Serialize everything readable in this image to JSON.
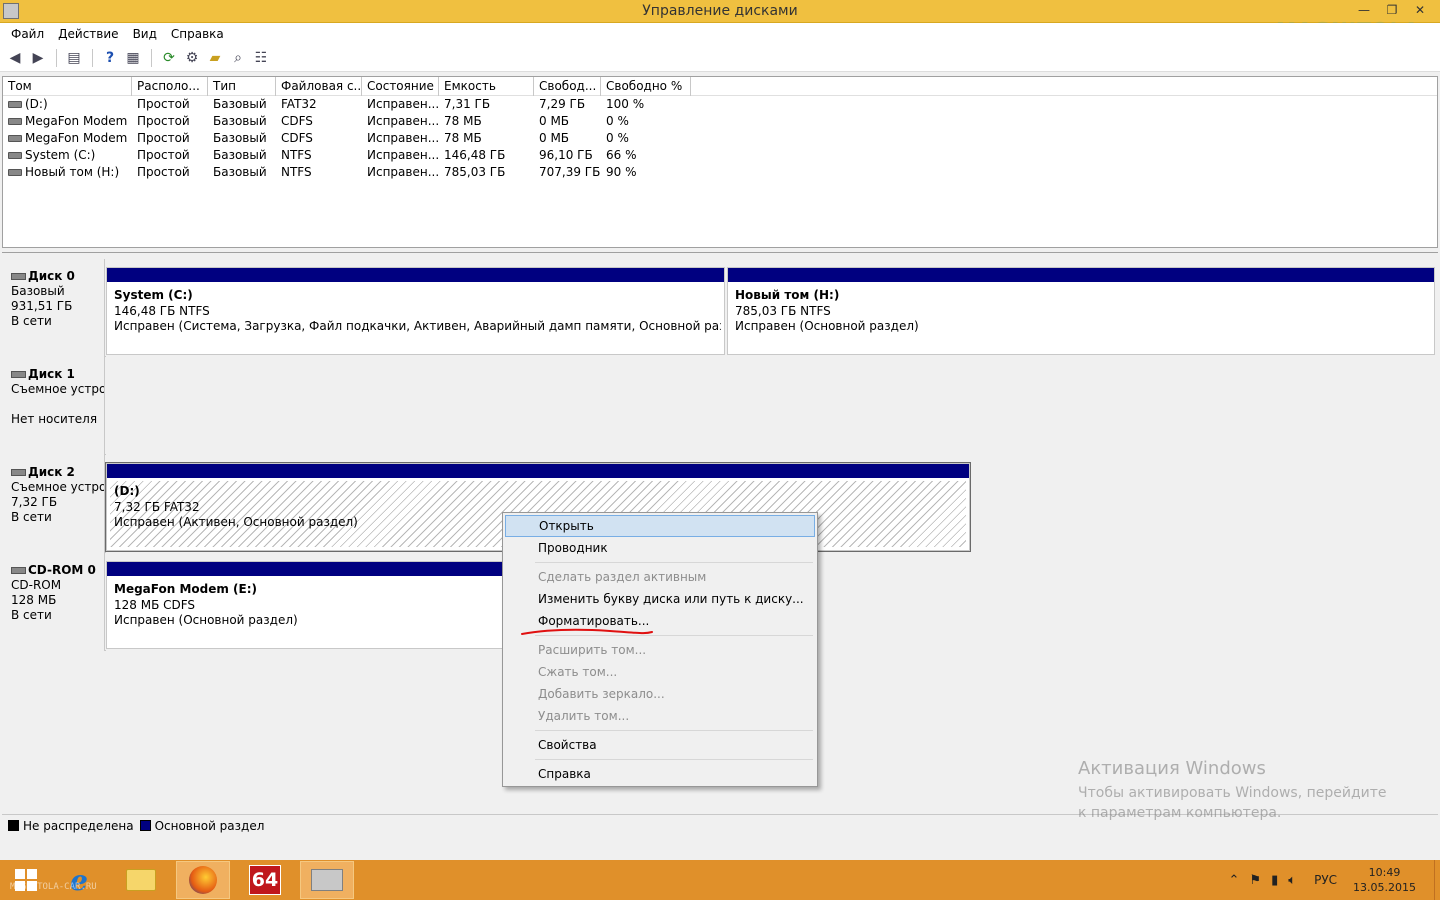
{
  "window": {
    "title": "Управление дисками",
    "controls": [
      "—",
      "❐",
      "✕"
    ],
    "watermark": "MAGNITOLA"
  },
  "menu": [
    "Файл",
    "Действие",
    "Вид",
    "Справка"
  ],
  "volume_list": {
    "columns": [
      "Том",
      "Располо...",
      "Тип",
      "Файловая с...",
      "Состояние",
      "Емкость",
      "Свобод...",
      "Свободно %"
    ],
    "rows": [
      {
        "name": "(D:)",
        "layout": "Простой",
        "type": "Базовый",
        "fs": "FAT32",
        "status": "Исправен...",
        "capacity": "7,31 ГБ",
        "free": "7,29 ГБ",
        "free_pct": "100 %"
      },
      {
        "name": "MegaFon Modem ...",
        "layout": "Простой",
        "type": "Базовый",
        "fs": "CDFS",
        "status": "Исправен...",
        "capacity": "78 МБ",
        "free": "0 МБ",
        "free_pct": "0 %"
      },
      {
        "name": "MegaFon Modem ...",
        "layout": "Простой",
        "type": "Базовый",
        "fs": "CDFS",
        "status": "Исправен...",
        "capacity": "78 МБ",
        "free": "0 МБ",
        "free_pct": "0 %"
      },
      {
        "name": "System (C:)",
        "layout": "Простой",
        "type": "Базовый",
        "fs": "NTFS",
        "status": "Исправен...",
        "capacity": "146,48 ГБ",
        "free": "96,10 ГБ",
        "free_pct": "66 %"
      },
      {
        "name": "Новый том (H:)",
        "layout": "Простой",
        "type": "Базовый",
        "fs": "NTFS",
        "status": "Исправен...",
        "capacity": "785,03 ГБ",
        "free": "707,39 ГБ",
        "free_pct": "90 %"
      }
    ]
  },
  "disks": [
    {
      "name": "Диск 0",
      "line1": "Базовый",
      "line2": "931,51 ГБ",
      "line3": "В сети",
      "partitions": [
        {
          "name": "System  (C:)",
          "size": "146,48 ГБ NTFS",
          "status": "Исправен (Система, Загрузка, Файл подкачки, Активен, Аварийный дамп памяти, Основной раздел)"
        },
        {
          "name": "Новый том  (H:)",
          "size": "785,03 ГБ NTFS",
          "status": "Исправен (Основной раздел)"
        }
      ]
    },
    {
      "name": "Диск 1",
      "line1": "Съемное устройство",
      "line2": "",
      "line3": "Нет носителя",
      "partitions": []
    },
    {
      "name": "Диск 2",
      "line1": "Съемное устройство",
      "line2": "7,32 ГБ",
      "line3": "В сети",
      "partitions": [
        {
          "name": "(D:)",
          "size": "7,32 ГБ FAT32",
          "status": "Исправен (Активен, Основной раздел)"
        }
      ]
    },
    {
      "name": "CD-ROM 0",
      "line1": "CD-ROM",
      "line2": "128 МБ",
      "line3": "В сети",
      "partitions": [
        {
          "name": "MegaFon Modem  (E:)",
          "size": "128 МБ CDFS",
          "status": "Исправен (Основной раздел)"
        }
      ]
    }
  ],
  "legend": [
    {
      "label": "Не распределена",
      "color": "#000000"
    },
    {
      "label": "Основной раздел",
      "color": "#000080"
    }
  ],
  "context_menu": {
    "open": "Открыть",
    "explorer": "Проводник",
    "make_active": "Сделать раздел активным",
    "change_letter": "Изменить букву диска или путь к диску...",
    "format": "Форматировать...",
    "extend": "Расширить том...",
    "shrink": "Сжать том...",
    "add_mirror": "Добавить зеркало...",
    "delete": "Удалить том...",
    "properties": "Свойства",
    "help": "Справка"
  },
  "activation": {
    "title": "Активация Windows",
    "text": "Чтобы активировать Windows, перейдите к параметрам компьютера."
  },
  "taskbar": {
    "aida_label": "64",
    "lang": "РУС",
    "time": "10:49",
    "date": "13.05.2015",
    "watermark": "MAGNITOLA-CAR.RU"
  },
  "colors": {
    "titlebar": "#f0c040",
    "taskbar": "#e0902a",
    "primary_partition": "#000080",
    "menu_highlight": "#d1e2f2",
    "annotation": "#e01010"
  }
}
